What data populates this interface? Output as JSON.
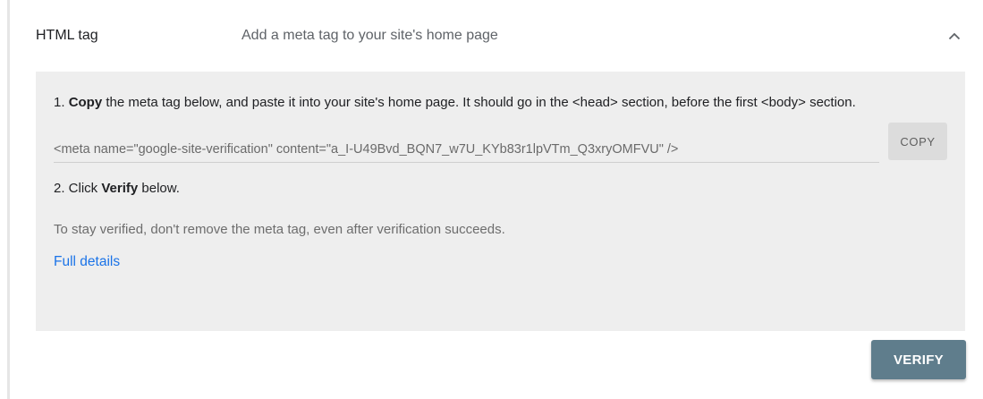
{
  "header": {
    "method_label": "HTML tag",
    "description": "Add a meta tag to your site's home page",
    "collapse_icon": "chevron-up-icon"
  },
  "instructions": {
    "step1_prefix": "1. ",
    "step1_bold": "Copy",
    "step1_rest": " the meta tag below, and paste it into your site's home page. It should go in the <head> section, before the first <body> section.",
    "meta_tag": "<meta name=\"google-site-verification\" content=\"a_I-U49Bvd_BQN7_w7U_KYb83r1lpVTm_Q3xryOMFVU\" />",
    "copy_label": "COPY",
    "step2_prefix": "2. Click ",
    "step2_bold": "Verify",
    "step2_rest": " below.",
    "note": "To stay verified, don't remove the meta tag, even after verification succeeds.",
    "details_link": "Full details"
  },
  "actions": {
    "verify_label": "VERIFY"
  },
  "colors": {
    "panel_bg": "#eeeeee",
    "link": "#1a73e8",
    "verify_bg": "#5f7d8c"
  }
}
